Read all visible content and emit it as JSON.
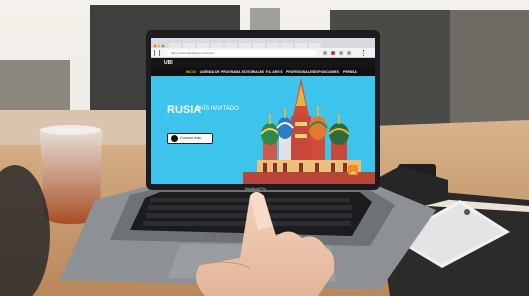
{
  "browser": {
    "url": "http://www.sietebijsaro.com/ruso"
  },
  "site": {
    "logo": "UBI",
    "nav": [
      "INICIO",
      "AGENDA DE",
      "PROGRAMA",
      "EDITORIALES",
      "F.IL ARG'S",
      "PROFESIONALES",
      "EXPOSICIONES",
      "PRENSA"
    ],
    "active_index": 0,
    "hero_title": "RUSIA",
    "hero_subtitle": "PAÍS INVITADO",
    "cta_label": "Conocer más"
  },
  "laptop": {
    "model": "MacBook Pro"
  },
  "colors": {
    "screen_bg": "#3cc4ec",
    "nav_bg": "#101010",
    "accent": "#f0a43c",
    "desk": "#c89f73",
    "wall": "#eeeae4"
  }
}
